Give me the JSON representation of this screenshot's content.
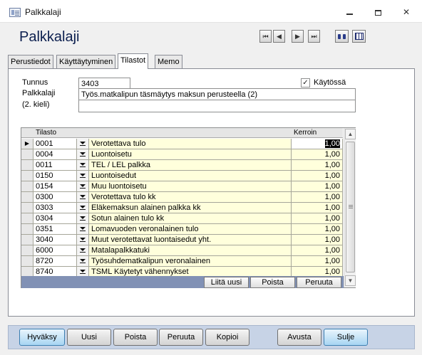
{
  "window": {
    "title": "Palkkalaji",
    "min": "—",
    "max": "▢",
    "close": "✕"
  },
  "form": {
    "title": "Palkkalaji"
  },
  "nav": {
    "first": "⏮",
    "prev": "◀",
    "next": "▶",
    "last": "⏭"
  },
  "tabs": [
    {
      "label": "Perustiedot",
      "active": false
    },
    {
      "label": "Käyttäytyminen",
      "active": false
    },
    {
      "label": "Tilastot",
      "active": true
    },
    {
      "label": "Memo",
      "active": false
    }
  ],
  "fields": {
    "tunnus_label": "Tunnus",
    "tunnus_value": "3403",
    "palkkalaji_label": "Palkkalaji",
    "palkkalaji_value": "Työs.matkalipun täsmäytys maksun perusteella (2)",
    "kieli_label": "(2. kieli)",
    "kieli_value": "",
    "kaytossa_label": "Käytössä",
    "kaytossa_checked": "✓"
  },
  "table": {
    "header_tilasto": "Tilasto",
    "header_kerroin": "Kerroin",
    "selector_glyph": "▶",
    "rows": [
      {
        "code": "0001",
        "desc": "Verotettava tulo",
        "coef": "1,00"
      },
      {
        "code": "0004",
        "desc": "Luontoisetu",
        "coef": "1,00"
      },
      {
        "code": "0011",
        "desc": "TEL / LEL palkka",
        "coef": "1,00"
      },
      {
        "code": "0150",
        "desc": "Luontoisedut",
        "coef": "1,00"
      },
      {
        "code": "0154",
        "desc": "Muu luontoisetu",
        "coef": "1,00"
      },
      {
        "code": "0300",
        "desc": "Verotettava tulo kk",
        "coef": "1,00"
      },
      {
        "code": "0303",
        "desc": "Eläkemaksun alainen palkka kk",
        "coef": "1,00"
      },
      {
        "code": "0304",
        "desc": "Sotun alainen tulo kk",
        "coef": "1,00"
      },
      {
        "code": "0351",
        "desc": "Lomavuoden veronalainen tulo",
        "coef": "1,00"
      },
      {
        "code": "3040",
        "desc": "Muut verotettavat luontaisedut yht.",
        "coef": "1,00"
      },
      {
        "code": "6000",
        "desc": "Matalapalkkatuki",
        "coef": "1,00"
      },
      {
        "code": "8720",
        "desc": "Työsuhdematkalipun veronalainen",
        "coef": "1,00"
      },
      {
        "code": "8740",
        "desc": "TSML Käytetyt vähennykset",
        "coef": "1,00"
      }
    ],
    "scroll_up": "▲",
    "scroll_down": "▼"
  },
  "subform_buttons": {
    "liita": "Liitä uusi",
    "poista": "Poista",
    "peruuta": "Peruuta"
  },
  "bottom_buttons": {
    "hyvaksy": "Hyväksy",
    "uusi": "Uusi",
    "poista": "Poista",
    "peruuta": "Peruuta",
    "kopioi": "Kopioi",
    "avusta": "Avusta",
    "sulje": "Sulje"
  }
}
